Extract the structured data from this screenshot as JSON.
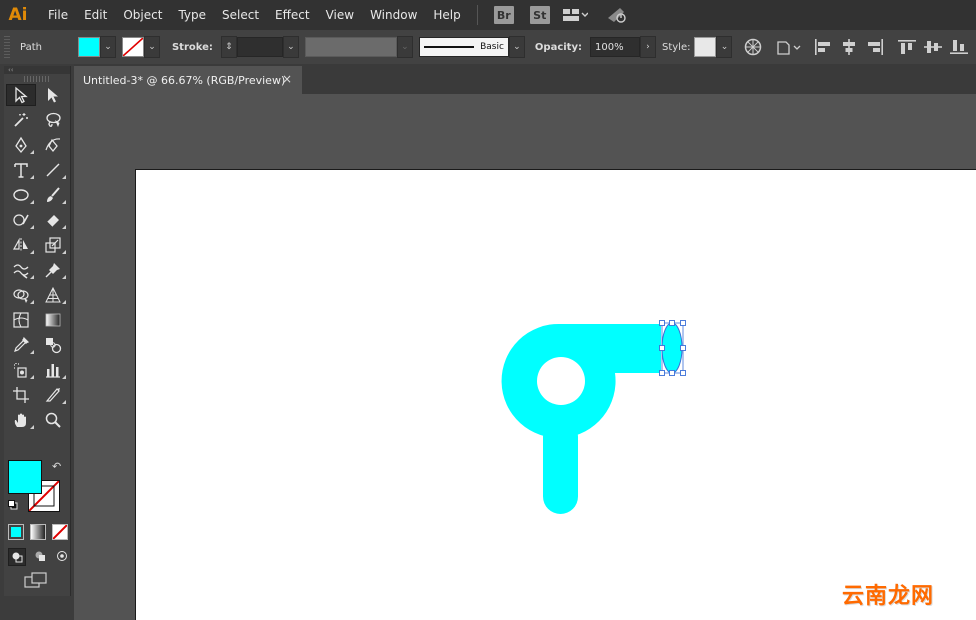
{
  "app": {
    "logo_text": "Ai",
    "logo_color": "#ff9a00"
  },
  "menu": [
    "File",
    "Edit",
    "Object",
    "Type",
    "Select",
    "Effect",
    "View",
    "Window",
    "Help"
  ],
  "menubar_apps": [
    {
      "name": "bridge",
      "label": "Br"
    },
    {
      "name": "stock",
      "label": "St"
    }
  ],
  "control_bar": {
    "selection_type": "Path",
    "fill_color": "#00ffff",
    "stroke_label": "Stroke:",
    "brush_label": "Basic",
    "opacity_label": "Opacity:",
    "opacity_value": "100%",
    "style_label": "Style:"
  },
  "document": {
    "tab_title": "Untitled-3* @ 66.67% (RGB/Preview)",
    "close_symbol": "×"
  },
  "toolbar": {
    "fill_color": "#00ffff",
    "stroke_color": "none",
    "tools": [
      "selection-tool",
      "direct-selection-tool",
      "magic-wand-tool",
      "lasso-tool",
      "pen-tool",
      "curvature-tool",
      "type-tool",
      "line-segment-tool",
      "ellipse-tool",
      "paintbrush-tool",
      "shaper-tool",
      "eraser-tool",
      "reflect-tool",
      "scale-tool",
      "warp-tool",
      "puppet-warp-tool",
      "shape-builder-tool",
      "perspective-grid-tool",
      "mesh-tool",
      "gradient-tool",
      "eyedropper-tool",
      "blend-tool",
      "symbol-sprayer-tool",
      "column-graph-tool",
      "artboard-tool",
      "slice-tool",
      "hand-tool",
      "zoom-tool"
    ]
  },
  "artwork": {
    "shape_color": "#00ffff",
    "selection_color": "#3a6fd8"
  },
  "watermark": {
    "text": "云南龙网",
    "color": "#ff6a00"
  }
}
